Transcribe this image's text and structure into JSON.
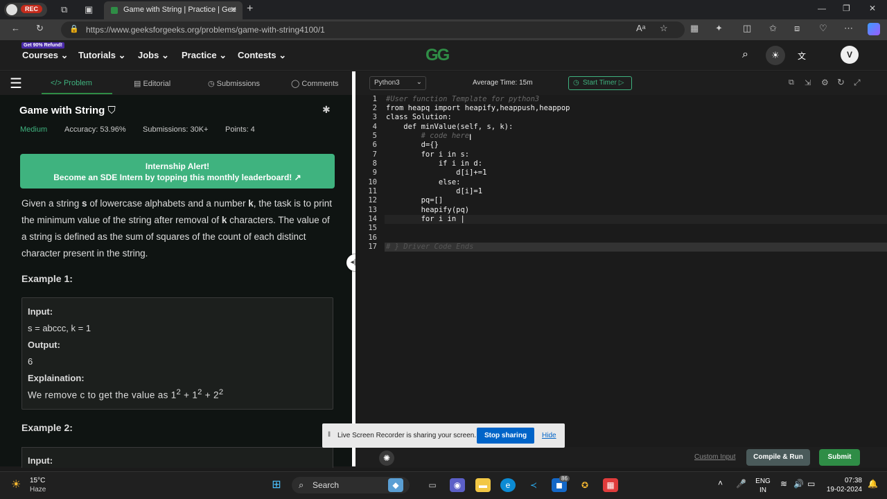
{
  "browser": {
    "tab_title": "Game with String | Practice | Gee",
    "url": "https://www.geeksforgeeks.org/problems/game-with-string4100/1",
    "rec_label": "REC"
  },
  "header": {
    "promo": "Get 90% Refund!",
    "nav": [
      "Courses",
      "Tutorials",
      "Jobs",
      "Practice",
      "Contests"
    ],
    "logo": "GG",
    "avatar": "V"
  },
  "problem": {
    "tabs": [
      "Problem",
      "Editorial",
      "Submissions",
      "Comments"
    ],
    "title": "Game with String",
    "difficulty": "Medium",
    "accuracy": "Accuracy: 53.96%",
    "submissions": "Submissions: 30K+",
    "points": "Points: 4",
    "banner_line1": "Internship Alert!",
    "banner_line2": "Become an SDE Intern by topping this monthly leaderboard!",
    "desc_1": "Given a string ",
    "desc_s": "s",
    "desc_2": " of lowercase alphabets and a number ",
    "desc_k": "k",
    "desc_3": ", the task is to print the minimum value of the string after removal of ",
    "desc_k2": "k",
    "desc_4": " characters. The value of a string is defined as the sum of squares of the count of each distinct character present in the string.",
    "example1_title": "Example 1:",
    "input_label": "Input:",
    "input_value": "s = abccc, k = 1",
    "output_label": "Output:",
    "output_value": "6",
    "explain_label": "Explaination:",
    "explain_value": "We remove c to get the value as 1",
    "explain_sup": "2",
    "explain_rest1": " + 1",
    "explain_rest2": " + 2",
    "example2_title": "Example 2:",
    "input_label2": "Input:"
  },
  "editor": {
    "language": "Python3",
    "avg_time": "Average Time: 15m",
    "start_timer": "Start Timer",
    "line_numbers": [
      "1",
      "2",
      "3",
      "4",
      "5",
      "6",
      "7",
      "8",
      "9",
      "10",
      "11",
      "12",
      "13",
      "14",
      "15",
      "16",
      "17"
    ],
    "lines": [
      "#User function Template for python3",
      "from heapq import heapify,heappush,heappop",
      "class Solution:",
      "    def minValue(self, s, k):",
      "        # code here",
      "        d={}",
      "        for i in s:",
      "            if i in d:",
      "                d[i]+=1",
      "            else:",
      "                d[i]=1",
      "        pq=[]",
      "        heapify(pq)",
      "        for i in |",
      "",
      "",
      "# } Driver Code Ends"
    ],
    "custom_input": "Custom Input",
    "compile_run": "Compile & Run",
    "submit": "Submit"
  },
  "sharing": {
    "message": "Live Screen Recorder is sharing your screen.",
    "stop": "Stop sharing",
    "hide": "Hide"
  },
  "taskbar": {
    "temp": "15°C",
    "condition": "Haze",
    "search": "Search",
    "badge": "86",
    "lang1": "ENG",
    "lang2": "IN",
    "time": "07:38",
    "date": "19-02-2024"
  }
}
